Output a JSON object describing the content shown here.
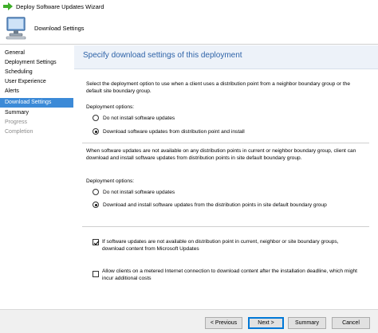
{
  "window": {
    "title": "Deploy Software Updates Wizard"
  },
  "banner": {
    "title": "Download Settings"
  },
  "nav": {
    "items": [
      {
        "label": "General",
        "state": "normal"
      },
      {
        "label": "Deployment Settings",
        "state": "normal"
      },
      {
        "label": "Scheduling",
        "state": "normal"
      },
      {
        "label": "User Experience",
        "state": "normal"
      },
      {
        "label": "Alerts",
        "state": "normal"
      },
      {
        "label": "Download Settings",
        "state": "active"
      },
      {
        "label": "Summary",
        "state": "normal"
      },
      {
        "label": "Progress",
        "state": "disabled"
      },
      {
        "label": "Completion",
        "state": "disabled"
      }
    ]
  },
  "content": {
    "header": "Specify download settings of this deployment",
    "intro": "Select the deployment option to use when a client uses a distribution point from a neighbor boundary group or the default site boundary group.",
    "group1": {
      "label": "Deployment options:",
      "options": [
        {
          "label": "Do not install software updates",
          "selected": false
        },
        {
          "label": "Download software updates from distribution point and install",
          "selected": true
        }
      ]
    },
    "middle_text": "When software updates are not available on any distribution points in current or neighbor boundary group, client can download and install software updates from distribution points in site default boundary group.",
    "group2": {
      "label": "Deployment options:",
      "options": [
        {
          "label": "Do not install software updates",
          "selected": false
        },
        {
          "label": "Download and install software updates from the distribution points in site default boundary group",
          "selected": true
        }
      ]
    },
    "checkboxes": [
      {
        "label": "If software updates are not available on distribution point in current, neighbor or site boundary groups, download content from Microsoft Updates",
        "checked": true
      },
      {
        "label": "Allow clients on a metered Internet connection to download content after the installation deadline, which might incur additional costs",
        "checked": false
      }
    ]
  },
  "footer": {
    "previous": "< Previous",
    "next": "Next >",
    "summary": "Summary",
    "cancel": "Cancel"
  },
  "colors": {
    "accent": "#3c8ad7",
    "header_text": "#2e63a8",
    "header_bg": "#edf2f9"
  }
}
